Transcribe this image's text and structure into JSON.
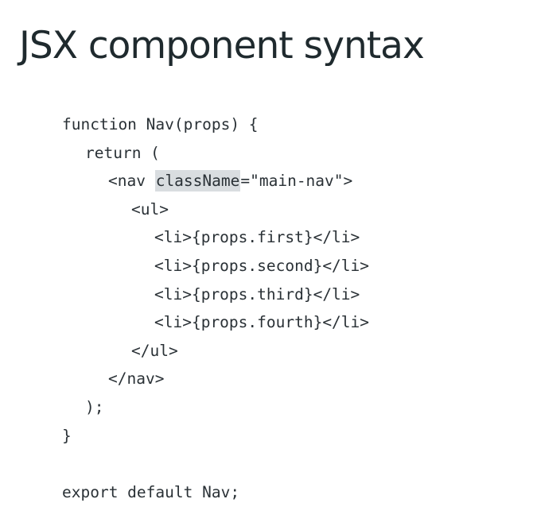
{
  "slide": {
    "title": "JSX component syntax",
    "highlight_color": "#d9dde0",
    "code": {
      "line1": "function Nav(props) {",
      "line2": "return (",
      "line3_pre": "<nav ",
      "line3_highlight": "className",
      "line3_post": "=\"main-nav\">",
      "line4": "<ul>",
      "line5": "<li>{props.first}</li>",
      "line6": "<li>{props.second}</li>",
      "line7": "<li>{props.third}</li>",
      "line8": "<li>{props.fourth}</li>",
      "line9": "</ul>",
      "line10": "</nav>",
      "line11": ");",
      "line12": "}",
      "line14": "export default Nav;"
    }
  }
}
